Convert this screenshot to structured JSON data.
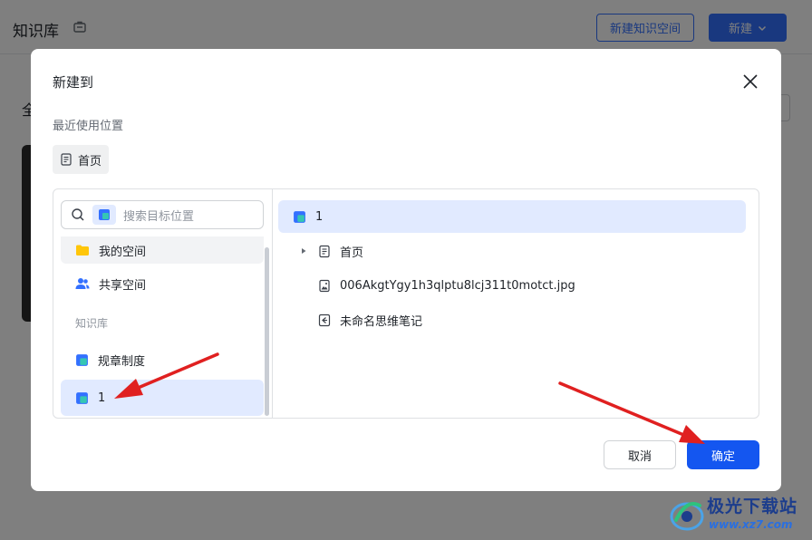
{
  "background": {
    "title": "知识库",
    "new_space_button": "新建知识空间",
    "new_button": "新建",
    "side_text": "全"
  },
  "dialog": {
    "title": "新建到",
    "recent_label": "最近使用位置",
    "recent_item": "首页",
    "search_placeholder": "搜索目标位置",
    "nav": {
      "my_space": "我的空间",
      "shared_space": "共享空间",
      "section": "知识库",
      "rules": "规章制度",
      "one": "1"
    },
    "tree": {
      "root": "1",
      "homepage": "首页",
      "image_file": "006AkgtYgy1h3qlptu8lcj311t0motct.jpg",
      "mindnote": "未命名思维笔记"
    },
    "cancel": "取消",
    "confirm": "确定"
  },
  "watermark": {
    "name": "极光下载站",
    "url": "www.xz7.com"
  },
  "colors": {
    "primary": "#1456f0",
    "selected_bg": "#e1eaff",
    "arrow": "#e02020"
  }
}
